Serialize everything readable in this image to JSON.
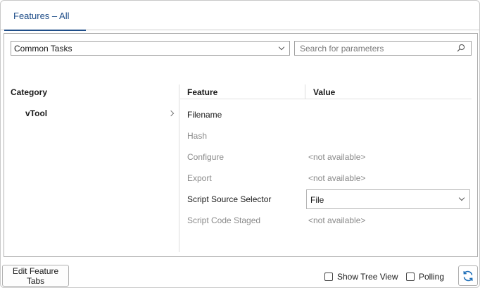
{
  "tabs": [
    {
      "label": "Features – All"
    }
  ],
  "toolbar": {
    "task_select": {
      "value": "Common Tasks"
    },
    "search": {
      "placeholder": "Search for parameters",
      "value": ""
    }
  },
  "columns": {
    "category": "Category",
    "feature": "Feature",
    "value": "Value"
  },
  "categories": [
    {
      "label": "vTool"
    }
  ],
  "features": [
    {
      "name": "Filename",
      "value": "",
      "enabled": true
    },
    {
      "name": "Hash",
      "value": "",
      "enabled": false
    },
    {
      "name": "Configure",
      "value": "<not available>",
      "enabled": false
    },
    {
      "name": "Export",
      "value": "<not available>",
      "enabled": false
    },
    {
      "name": "Script Source Selector",
      "value": "File",
      "enabled": true,
      "control": "select"
    },
    {
      "name": "Script Code Staged",
      "value": "<not available>",
      "enabled": false
    }
  ],
  "footer": {
    "edit_tabs_label": "Edit Feature Tabs",
    "show_tree_view": {
      "label": "Show Tree View",
      "checked": false
    },
    "polling": {
      "label": "Polling",
      "checked": false
    }
  },
  "colors": {
    "accent": "#1f4e89",
    "disabled_text": "#8a8a8a",
    "refresh_icon": "#1f6fb8"
  }
}
